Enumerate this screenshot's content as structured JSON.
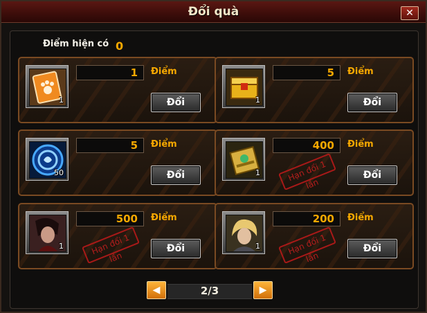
{
  "window": {
    "title": "Đổi quà",
    "close_label": "✕"
  },
  "points": {
    "label": "Điểm hiện có",
    "value": "0"
  },
  "unit_label": "Điểm",
  "exchange_label": "Đổi",
  "limit_stamp": "Hạn đổi 1 lần",
  "items": [
    {
      "icon": "paw-card-icon",
      "qty": "1",
      "price": "1",
      "limited": false
    },
    {
      "icon": "golden-chest-icon",
      "qty": "1",
      "price": "5",
      "limited": false
    },
    {
      "icon": "blue-orb-icon",
      "qty": "50",
      "price": "5",
      "limited": false
    },
    {
      "icon": "jade-chest-icon",
      "qty": "1",
      "price": "400",
      "limited": true
    },
    {
      "icon": "dark-hero-portrait",
      "qty": "1",
      "price": "500",
      "limited": true
    },
    {
      "icon": "blonde-hero-portrait",
      "qty": "1",
      "price": "200",
      "limited": true
    }
  ],
  "pager": {
    "prev": "◀",
    "next": "▶",
    "page_text": "2/3"
  }
}
